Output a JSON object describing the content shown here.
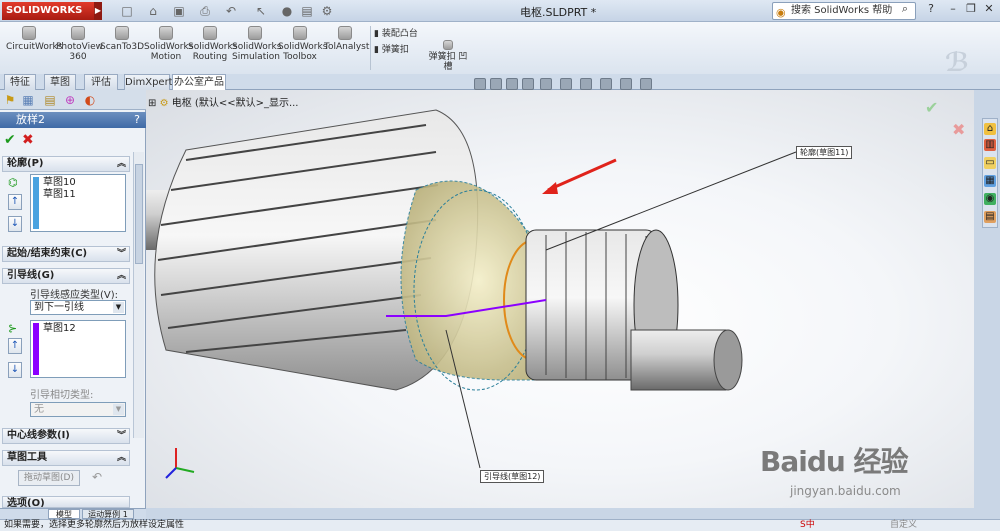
{
  "app": {
    "logo": "SOLIDWORKS",
    "document_title": "电枢.SLDPRT *"
  },
  "help_search": {
    "placeholder": "搜索 SolidWorks 帮助"
  },
  "ribbon": {
    "buttons": [
      {
        "label": "CircuitWorks"
      },
      {
        "label": "PhotoView 360"
      },
      {
        "label": "ScanTo3D"
      },
      {
        "label": "SolidWorks Motion"
      },
      {
        "label": "SolidWorks Routing"
      },
      {
        "label": "SolidWorks Simulation"
      },
      {
        "label": "SolidWorks Toolbox"
      },
      {
        "label": "TolAnalyst"
      }
    ],
    "small_buttons": [
      {
        "label": "装配凸台"
      },
      {
        "label": "弹簧扣"
      },
      {
        "label": "弹簧扣 凹槽"
      }
    ]
  },
  "tabs": [
    {
      "label": "特征"
    },
    {
      "label": "草图"
    },
    {
      "label": "评估"
    },
    {
      "label": "DimXpert"
    },
    {
      "label": "办公室产品",
      "active": true
    }
  ],
  "property_manager": {
    "title": "放样2",
    "help": "?",
    "sections": {
      "profiles": {
        "title": "轮廓(P)",
        "items": [
          "草图10",
          "草图11"
        ]
      },
      "start_end": {
        "title": "起始/结束约束(C)"
      },
      "guides": {
        "title": "引导线(G)",
        "influence_label": "引导线感应类型(V):",
        "influence_value": "到下一引线",
        "items": [
          "草图12"
        ],
        "tangency_label": "引导相切类型:",
        "tangency_value": "无"
      },
      "centerline": {
        "title": "中心线参数(I)"
      },
      "sketch_tools": {
        "title": "草图工具",
        "drag_button": "拖动草图(D)"
      },
      "options": {
        "title": "选项(O)"
      }
    }
  },
  "tree": {
    "text": "电枢 (默认<<默认>_显示..."
  },
  "callouts": {
    "profile": "轮廓(草图11)",
    "guide": "引导线(草图12)"
  },
  "bottom_tabs": [
    {
      "label": "模型"
    },
    {
      "label": "运动算例 1"
    }
  ],
  "status": {
    "text": "如果需要，选择更多轮廓然后为放样设定属性",
    "right": "自定义"
  },
  "watermark": {
    "text": "Baidu 经验",
    "sub": "jingyan.baidu.com"
  },
  "colors": {
    "accent": "#3f6aa6",
    "guide_bar": "#8b00ff",
    "profile_bar": "#4aa3e0",
    "arrow": "#e0231b"
  }
}
